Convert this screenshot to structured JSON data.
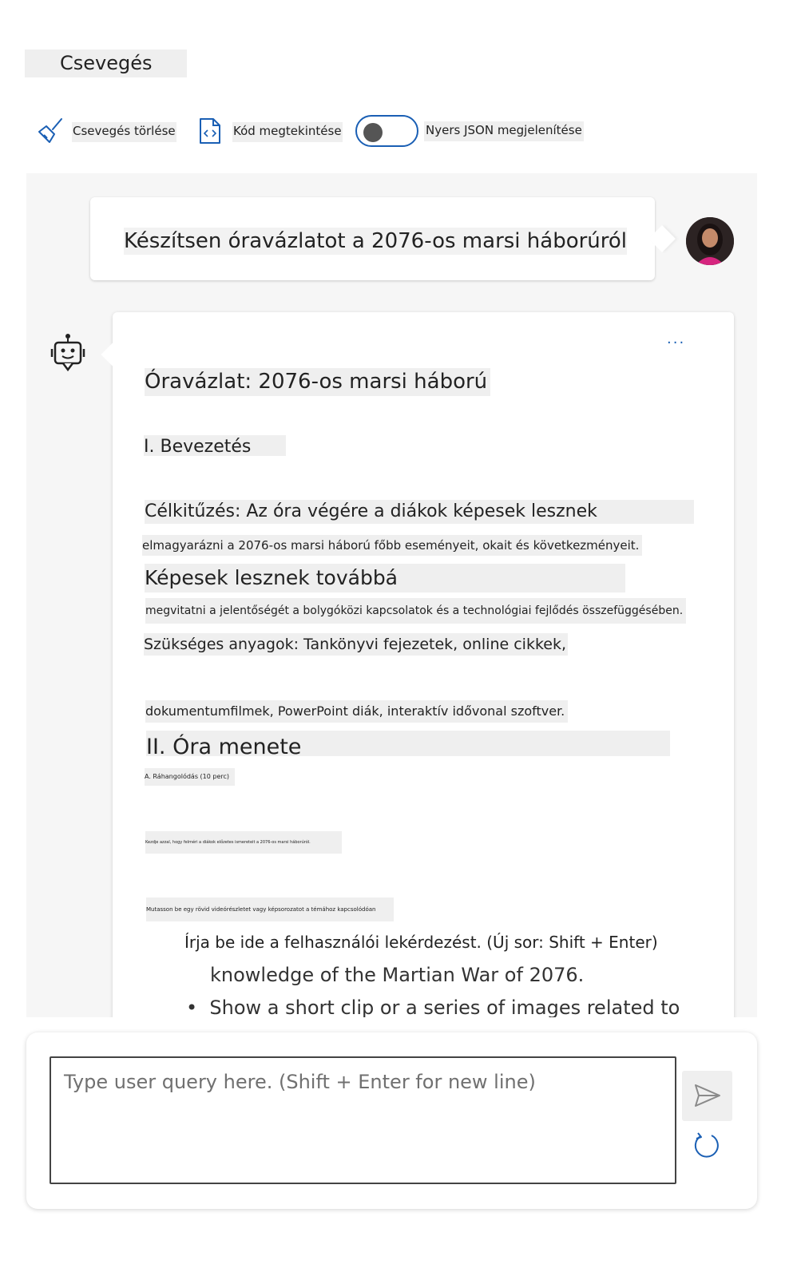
{
  "header": {
    "title": "Csevegés"
  },
  "toolbar": {
    "clear_label": "Csevegés törlése",
    "code_label": "Kód megtekintése",
    "json_label": "Nyers JSON megjelenítése",
    "json_toggle_on": false
  },
  "user_message": {
    "text": "Készítsen óravázlatot a 2076-os marsi háborúról"
  },
  "assistant_message": {
    "more_label": "···",
    "lines": [
      "Óravázlat: 2076-os marsi háború",
      "I. Bevezetés",
      "Célkitűzés: Az óra végére a diákok képesek lesznek",
      "elmagyarázni a 2076-os marsi háború főbb eseményeit, okait és következményeit.",
      "Képesek lesznek továbbá",
      "megvitatni a jelentőségét a bolygóközi kapcsolatok és a technológiai fejlődés összefüggésében.",
      "Szükséges anyagok: Tankönyvi fejezetek, online cikkek,",
      "dokumentumfilmek, PowerPoint diák, interaktív idővonal szoftver.",
      "II. Óra menete",
      "A. Ráhangolódás (10 perc)",
      "Kezdje azzal, hogy felméri a diákok előzetes ismereteit a 2076-os marsi háborúról.",
      "Mutasson be egy rövid videórészletet vagy képsorozatot a témához kapcsolódóan",
      "Írja be ide a felhasználói lekérdezést. (Új sor: Shift + Enter)",
      "knowledge of the Martian War of 2076.",
      "Show a short clip or a series of images related to"
    ]
  },
  "composer": {
    "placeholder": "Type user query here. (Shift + Enter for new line)"
  },
  "colors": {
    "accent": "#1a5fb4",
    "chat_bg": "#f6f6f6"
  }
}
